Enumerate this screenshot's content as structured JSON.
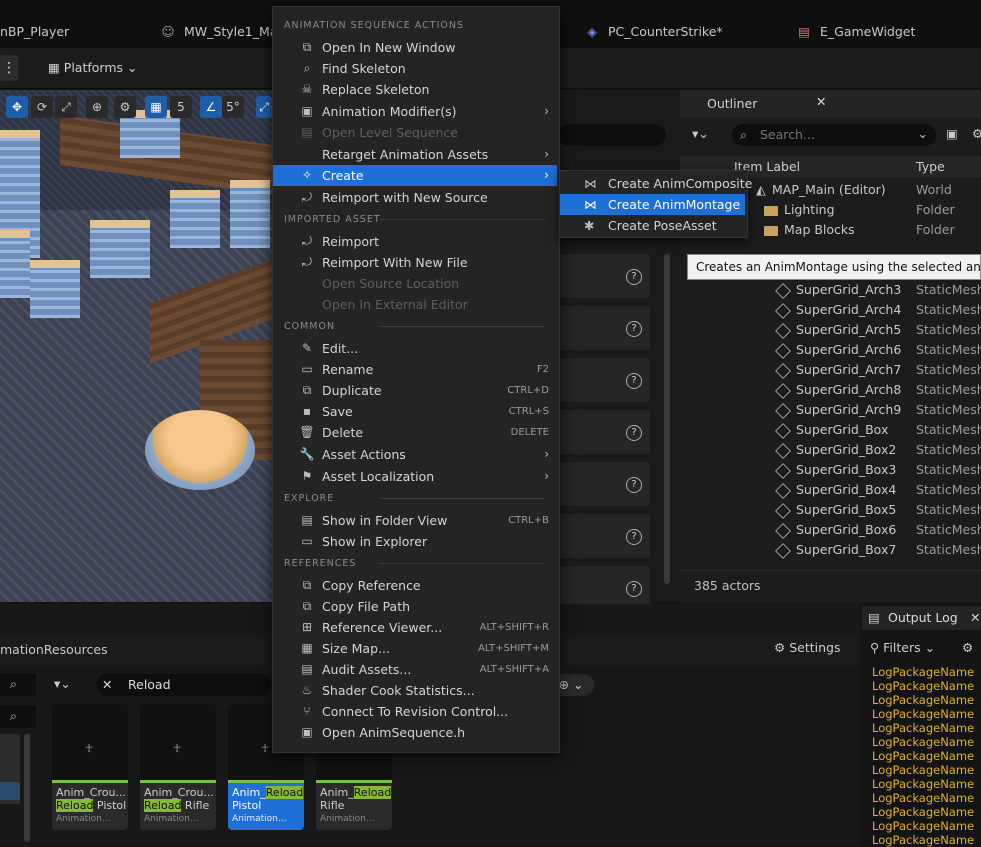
{
  "tabs": [
    {
      "label": "nBP_Player",
      "icon": "blueprint-icon"
    },
    {
      "label": "MW_Style1_Ma",
      "icon": "character-icon"
    },
    {
      "label": "PC_CounterStrike*",
      "icon": "gamepad-icon"
    },
    {
      "label": "E_GameWidget",
      "icon": "widget-icon"
    }
  ],
  "toolbar": {
    "platforms_label": "Platforms"
  },
  "viewport": {
    "grid_value": "5",
    "angle_value": "5°"
  },
  "outliner": {
    "title": "Outliner",
    "search_placeholder": "Search...",
    "col_label": "Item Label",
    "col_type": "Type",
    "rows": [
      {
        "label": "MAP_Main (Editor)",
        "type": "World"
      },
      {
        "label": "Lighting",
        "type": "Folder"
      },
      {
        "label": "Map Blocks",
        "type": "Folder"
      },
      {
        "label": "SuperGrid_Arch3",
        "type": "StaticMesh"
      },
      {
        "label": "SuperGrid_Arch4",
        "type": "StaticMesh"
      },
      {
        "label": "SuperGrid_Arch5",
        "type": "StaticMesh"
      },
      {
        "label": "SuperGrid_Arch6",
        "type": "StaticMesh"
      },
      {
        "label": "SuperGrid_Arch7",
        "type": "StaticMesh"
      },
      {
        "label": "SuperGrid_Arch8",
        "type": "StaticMesh"
      },
      {
        "label": "SuperGrid_Arch9",
        "type": "StaticMesh"
      },
      {
        "label": "SuperGrid_Box",
        "type": "StaticMesh"
      },
      {
        "label": "SuperGrid_Box2",
        "type": "StaticMesh"
      },
      {
        "label": "SuperGrid_Box3",
        "type": "StaticMesh"
      },
      {
        "label": "SuperGrid_Box4",
        "type": "StaticMesh"
      },
      {
        "label": "SuperGrid_Box5",
        "type": "StaticMesh"
      },
      {
        "label": "SuperGrid_Box6",
        "type": "StaticMesh"
      },
      {
        "label": "SuperGrid_Box7",
        "type": "StaticMesh"
      }
    ],
    "actors_count": "385 actors"
  },
  "menu": {
    "section_anim": "ANIMATION SEQUENCE ACTIONS",
    "section_imported": "IMPORTED ASSET",
    "section_common": "COMMON",
    "section_explore": "EXPLORE",
    "section_references": "REFERENCES",
    "items": [
      {
        "label": "Open In New Window",
        "shortcut": ""
      },
      {
        "label": "Find Skeleton",
        "shortcut": ""
      },
      {
        "label": "Replace Skeleton",
        "shortcut": ""
      },
      {
        "label": "Animation Modifier(s)",
        "shortcut": ""
      },
      {
        "label": "Open Level Sequence",
        "shortcut": ""
      },
      {
        "label": "Retarget Animation Assets",
        "shortcut": ""
      },
      {
        "label": "Create",
        "shortcut": ""
      },
      {
        "label": "Reimport with New Source",
        "shortcut": ""
      },
      {
        "label": "Reimport",
        "shortcut": ""
      },
      {
        "label": "Reimport With New File",
        "shortcut": ""
      },
      {
        "label": "Open Source Location",
        "shortcut": ""
      },
      {
        "label": "Open In External Editor",
        "shortcut": ""
      },
      {
        "label": "Edit...",
        "shortcut": ""
      },
      {
        "label": "Rename",
        "shortcut": "F2"
      },
      {
        "label": "Duplicate",
        "shortcut": "CTRL+D"
      },
      {
        "label": "Save",
        "shortcut": "CTRL+S"
      },
      {
        "label": "Delete",
        "shortcut": "DELETE"
      },
      {
        "label": "Asset Actions",
        "shortcut": ""
      },
      {
        "label": "Asset Localization",
        "shortcut": ""
      },
      {
        "label": "Show in Folder View",
        "shortcut": "CTRL+B"
      },
      {
        "label": "Show in Explorer",
        "shortcut": ""
      },
      {
        "label": "Copy Reference",
        "shortcut": ""
      },
      {
        "label": "Copy File Path",
        "shortcut": ""
      },
      {
        "label": "Reference Viewer...",
        "shortcut": "ALT+SHIFT+R"
      },
      {
        "label": "Size Map...",
        "shortcut": "ALT+SHIFT+M"
      },
      {
        "label": "Audit Assets...",
        "shortcut": "ALT+SHIFT+A"
      },
      {
        "label": "Shader Cook Statistics...",
        "shortcut": ""
      },
      {
        "label": "Connect To Revision Control...",
        "shortcut": ""
      },
      {
        "label": "Open AnimSequence.h",
        "shortcut": ""
      }
    ]
  },
  "submenu": {
    "items": [
      {
        "label": "Create AnimComposite"
      },
      {
        "label": "Create AnimMontage"
      },
      {
        "label": "Create PoseAsset"
      }
    ]
  },
  "tooltip": "Creates an AnimMontage using the selected anim sequence",
  "content_browser": {
    "path": "mationResources",
    "settings_label": "Settings",
    "search_value": "Reload",
    "assets": [
      {
        "name_pre": "Anim_Crou...",
        "highlight": "Reload",
        "name_post": " Pistol",
        "class": "Animation..."
      },
      {
        "name_pre": "Anim_Crou...",
        "highlight": "Reload",
        "name_post": " Rifle",
        "class": "Animation..."
      },
      {
        "name_pre": "Anim_",
        "highlight": "Reload",
        "name_post": "...",
        "line2": "Pistol",
        "class": "Animation..."
      },
      {
        "name_pre": "Anim_",
        "highlight": "Reload",
        "name_post": "",
        "line2": "Rifle",
        "class": "Animation..."
      }
    ]
  },
  "output_log": {
    "title": "Output Log",
    "filters_label": "Filters",
    "lines": [
      "LogPackageName",
      "LogPackageName",
      "LogPackageName",
      "LogPackageName",
      "LogPackageName",
      "LogPackageName",
      "LogPackageName",
      "LogPackageName",
      "LogPackageName",
      "LogPackageName",
      "LogPackageName",
      "LogPackageName",
      "LogPackageName"
    ]
  }
}
